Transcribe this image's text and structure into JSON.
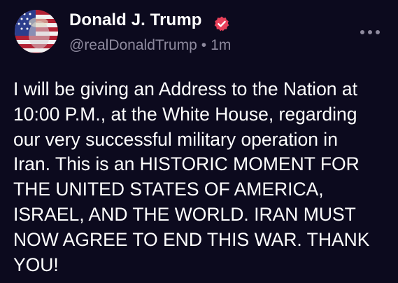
{
  "post": {
    "author": {
      "display_name": "Donald J. Trump",
      "handle": "@realDonaldTrump",
      "verified_icon": "verified-badge-icon",
      "avatar_icon": "flag-portrait-avatar"
    },
    "separator": "•",
    "timestamp": "1m",
    "more_icon": "more-options-icon",
    "body_lines": [
      "I will be giving an Address to the Nation at",
      "10:00 P.M., at the White House, regarding",
      "our very successful military operation in",
      "Iran. This is an HISTORIC MOMENT FOR",
      "THE UNITED STATES OF AMERICA,",
      "ISRAEL, AND THE WORLD. IRAN MUST",
      "NOW AGREE TO END THIS WAR. THANK",
      "YOU!"
    ]
  },
  "colors": {
    "background": "#0c0a1e",
    "text": "#ffffff",
    "muted": "#8e8a9e",
    "badge": "#e8405a"
  }
}
